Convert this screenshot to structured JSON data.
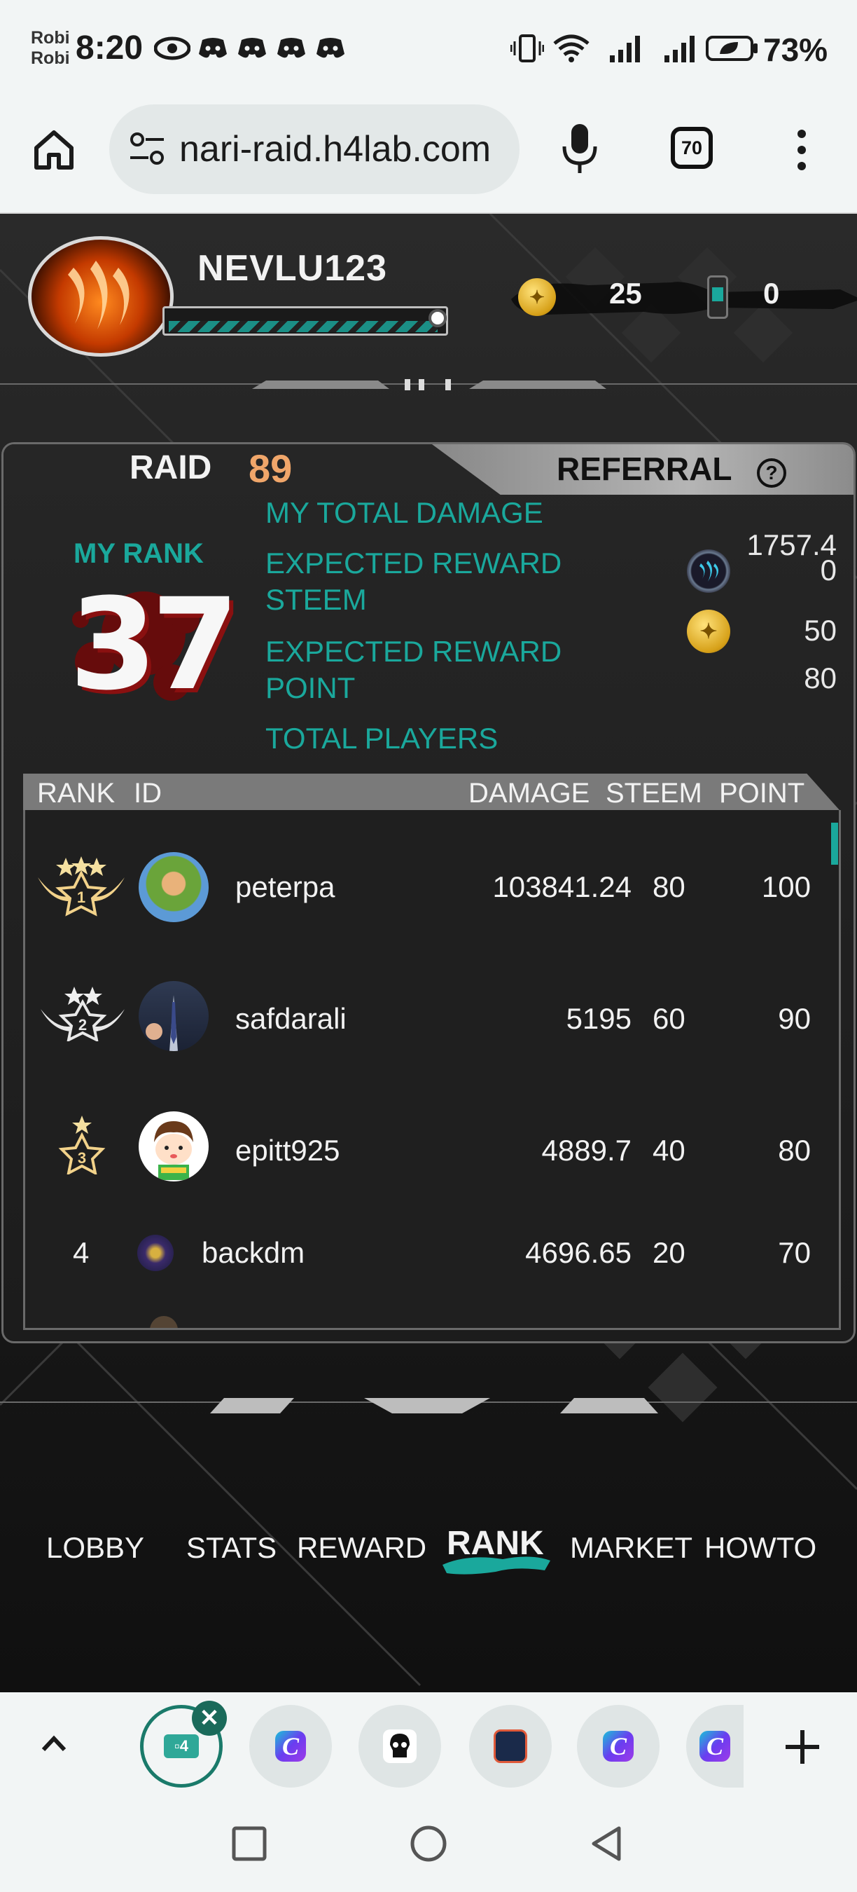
{
  "status_bar": {
    "carrier_line1": "Robi",
    "carrier_line2": "Robi",
    "time": "8:20",
    "battery": "73%"
  },
  "browser": {
    "url": "nari-raid.h4lab.com",
    "tab_count": "70"
  },
  "player": {
    "name": "NEVLU123",
    "coins": "25",
    "tickets": "0"
  },
  "tabs": {
    "raid_label": "RAID",
    "raid_number": "89",
    "referral_label": "REFERRAL",
    "help": "?"
  },
  "my_rank": {
    "label": "MY RANK",
    "value": "37"
  },
  "stats": {
    "total_damage_label": "MY TOTAL DAMAGE",
    "total_damage_value": "1757.4",
    "reward_steem_label_1": "EXPECTED REWARD",
    "reward_steem_label_2": "STEEM",
    "reward_steem_value": "0",
    "reward_point_label_1": "EXPECTED REWARD",
    "reward_point_label_2": "POINT",
    "reward_point_value": "50",
    "total_players_label": "TOTAL PLAYERS",
    "total_players_value": "80"
  },
  "table": {
    "headers": [
      "RANK",
      "ID",
      "DAMAGE",
      "STEEM",
      "POINT"
    ],
    "rows": [
      {
        "rank": "1",
        "id": "peterpa",
        "damage": "103841.24",
        "steem": "80",
        "point": "100"
      },
      {
        "rank": "2",
        "id": "safdarali",
        "damage": "5195",
        "steem": "60",
        "point": "90"
      },
      {
        "rank": "3",
        "id": "epitt925",
        "damage": "4889.7",
        "steem": "40",
        "point": "80"
      },
      {
        "rank": "4",
        "id": "backdm",
        "damage": "4696.65",
        "steem": "20",
        "point": "70"
      }
    ]
  },
  "nav": {
    "lobby": "LOBBY",
    "stats": "STATS",
    "reward": "REWARD",
    "rank": "RANK",
    "market": "MARKET",
    "howto": "HOWTO"
  },
  "colors": {
    "accent_teal": "#1aa89c",
    "raid_orange": "#f0a66a",
    "panel_bg": "#222222"
  }
}
